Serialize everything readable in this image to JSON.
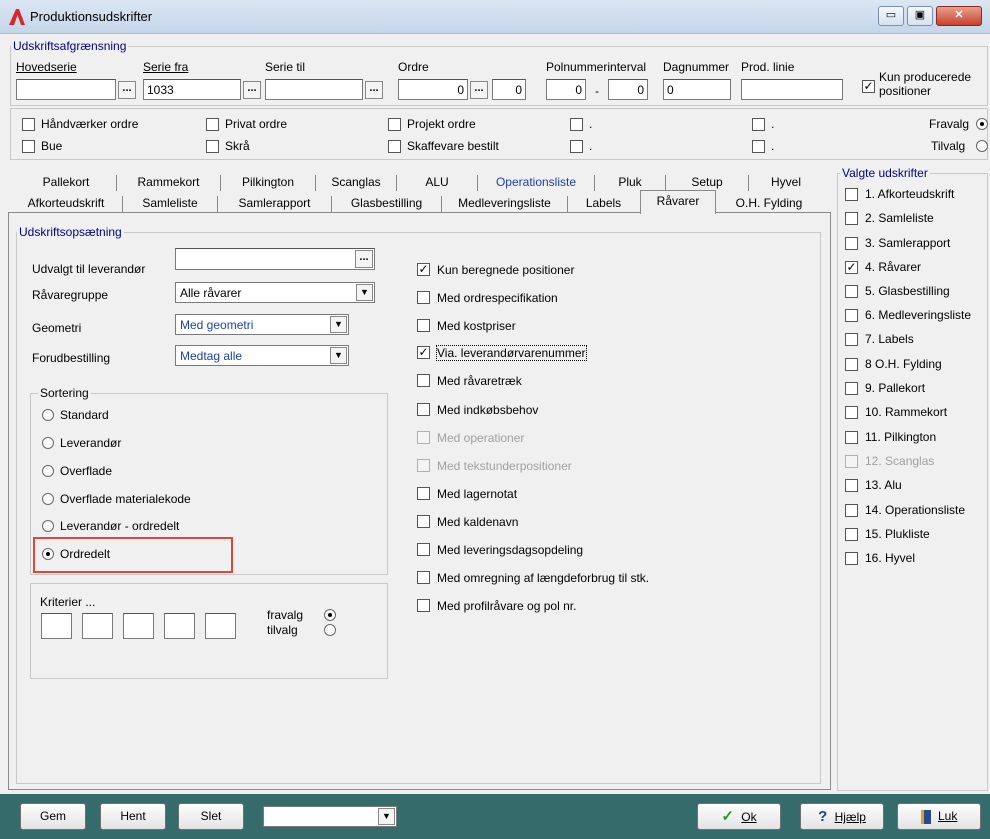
{
  "window": {
    "title": "Produktionsudskrifter",
    "btn_min": "▭",
    "btn_max": "▣",
    "btn_close": "✕"
  },
  "filter": {
    "group_title": "Udskriftsafgrænsning",
    "hovedserie_label": "Hovedserie",
    "hovedserie_value": "",
    "serie_fra_label": "Serie fra",
    "serie_fra_value": "1033",
    "serie_til_label": "Serie til",
    "serie_til_value": "",
    "ordre_label": "Ordre",
    "ordre_from": "0",
    "ordre_to": "0",
    "polnummer_label": "Polnummerinterval",
    "pol_from": "0",
    "pol_sep": "-",
    "pol_to": "0",
    "dagnummer_label": "Dagnummer",
    "dagnummer_value": "0",
    "prodlinie_label": "Prod. linie",
    "prodlinie_value": "",
    "kun_producerede_label": "Kun producerede positioner",
    "kun_producerede_checked": true,
    "ellipsis": "..."
  },
  "ordertypes": {
    "row1": [
      "Håndværker ordre",
      "Privat ordre",
      "Projekt ordre",
      ".",
      "."
    ],
    "row2": [
      "Bue",
      "Skrå",
      "Skaffevare bestilt",
      ".",
      "."
    ],
    "fravalg_label": "Fravalg",
    "tilvalg_label": "Tilvalg"
  },
  "tabs": {
    "row1": [
      "Pallekort",
      "Rammekort",
      "Pilkington",
      "Scanglas",
      "ALU",
      "Operationsliste",
      "Pluk",
      "Setup",
      "Hyvel"
    ],
    "row2": [
      "Afkorteudskrift",
      "Samleliste",
      "Samlerapport",
      "Glasbestilling",
      "Medleveringsliste",
      "Labels",
      "Råvarer",
      "O.H. Fylding"
    ],
    "active": "Råvarer"
  },
  "setup": {
    "group_title": "Udskriftsopsætning",
    "leverandor_label": "Udvalgt til leverandør",
    "leverandor_value": "",
    "ravaregruppe_label": "Råvaregruppe",
    "ravaregruppe_value": "Alle råvarer",
    "geometri_label": "Geometri",
    "geometri_value": "Med geometri",
    "forudbestilling_label": "Forudbestilling",
    "forudbestilling_value": "Medtag alle"
  },
  "sortering": {
    "title": "Sortering",
    "options": [
      "Standard",
      "Leverandør",
      "Overflade",
      "Overflade materialekode",
      "Leverandør - ordredelt",
      "Ordredelt"
    ],
    "selected": 5
  },
  "kriterier": {
    "title": "Kriterier ...",
    "fravalg_label": "fravalg",
    "tilvalg_label": "tilvalg"
  },
  "options": [
    {
      "label": "Kun beregnede positioner",
      "checked": true,
      "disabled": false
    },
    {
      "label": "Med ordrespecifikation",
      "checked": false,
      "disabled": false
    },
    {
      "label": "Med kostpriser",
      "checked": false,
      "disabled": false
    },
    {
      "label": "Via. leverandørvarenummer",
      "checked": true,
      "disabled": false
    },
    {
      "label": "Med råvaretræk",
      "checked": false,
      "disabled": false
    },
    {
      "label": "Med indkøbsbehov",
      "checked": false,
      "disabled": false
    },
    {
      "label": "Med operationer",
      "checked": false,
      "disabled": true
    },
    {
      "label": "Med tekstunderpositioner",
      "checked": false,
      "disabled": true
    },
    {
      "label": "Med lagernotat",
      "checked": false,
      "disabled": false
    },
    {
      "label": "Med kaldenavn",
      "checked": false,
      "disabled": false
    },
    {
      "label": "Med leveringsdagsopdeling",
      "checked": false,
      "disabled": false
    },
    {
      "label": "Med omregning af længdeforbrug til stk.",
      "checked": false,
      "disabled": false
    },
    {
      "label": "Med profilråvare og pol nr.",
      "checked": false,
      "disabled": false
    }
  ],
  "valgte": {
    "title": "Valgte udskrifter",
    "items": [
      {
        "label": "1. Afkorteudskrift",
        "checked": false,
        "disabled": false
      },
      {
        "label": "2. Samleliste",
        "checked": false,
        "disabled": false
      },
      {
        "label": "3. Samlerapport",
        "checked": false,
        "disabled": false
      },
      {
        "label": "4. Råvarer",
        "checked": true,
        "disabled": false
      },
      {
        "label": "5. Glasbestilling",
        "checked": false,
        "disabled": false
      },
      {
        "label": "6. Medleveringsliste",
        "checked": false,
        "disabled": false
      },
      {
        "label": "7. Labels",
        "checked": false,
        "disabled": false
      },
      {
        "label": "8 O.H. Fylding",
        "checked": false,
        "disabled": false
      },
      {
        "label": "9. Pallekort",
        "checked": false,
        "disabled": false
      },
      {
        "label": "10. Rammekort",
        "checked": false,
        "disabled": false
      },
      {
        "label": "11. Pilkington",
        "checked": false,
        "disabled": false
      },
      {
        "label": "12. Scanglas",
        "checked": false,
        "disabled": true
      },
      {
        "label": "13. Alu",
        "checked": false,
        "disabled": false
      },
      {
        "label": "14. Operationsliste",
        "checked": false,
        "disabled": false
      },
      {
        "label": "15. Plukliste",
        "checked": false,
        "disabled": false
      },
      {
        "label": "16. Hyvel",
        "checked": false,
        "disabled": false
      }
    ]
  },
  "footer": {
    "gem": "Gem",
    "hent": "Hent",
    "slet": "Slet",
    "dropdown_value": "",
    "ok": "Ok",
    "hjaelp": "Hjælp",
    "luk": "Luk"
  },
  "check_mark": "✓",
  "dd_arrow": "▼",
  "colors": {
    "footer": "#356b6b",
    "highlight": "#e0463a",
    "group_title": "#00008b"
  }
}
